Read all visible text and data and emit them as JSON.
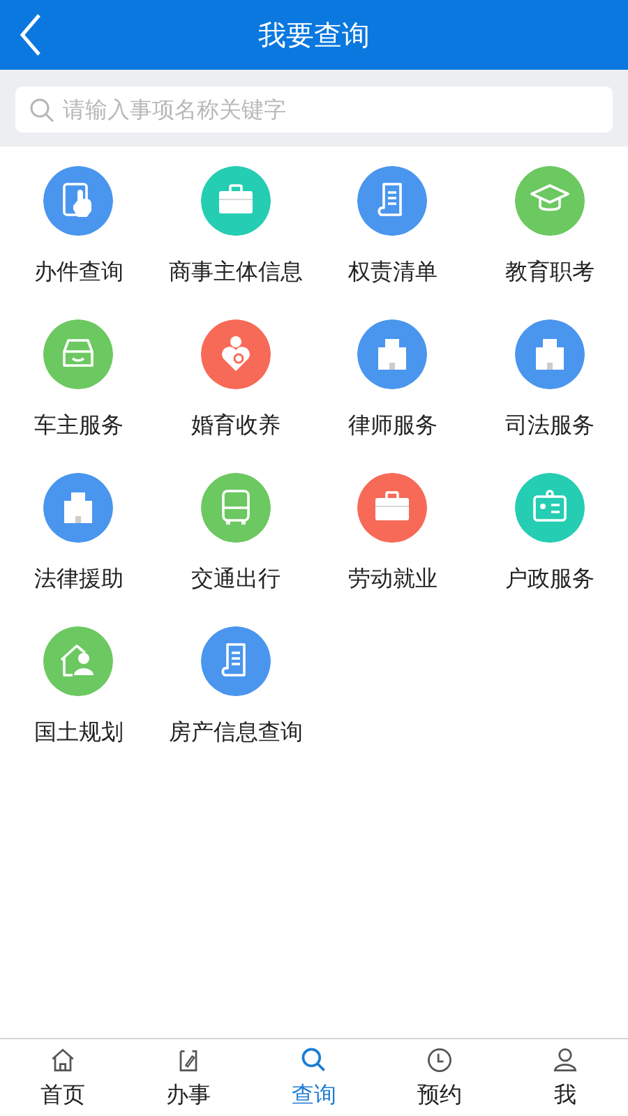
{
  "header": {
    "title": "我要查询"
  },
  "search": {
    "placeholder": "请输入事项名称关键字"
  },
  "services": [
    {
      "label": "办件查询",
      "kind": "document",
      "color": "#4a96ee"
    },
    {
      "label": "商事主体信息",
      "kind": "briefcase",
      "color": "#25cdb3"
    },
    {
      "label": "权责清单",
      "kind": "scroll",
      "color": "#4a96ee"
    },
    {
      "label": "教育职考",
      "kind": "cap",
      "color": "#6cc860"
    },
    {
      "label": "车主服务",
      "kind": "car",
      "color": "#6cc860"
    },
    {
      "label": "婚育收养",
      "kind": "family",
      "color": "#f76a58"
    },
    {
      "label": "律师服务",
      "kind": "building",
      "color": "#4a96ee"
    },
    {
      "label": "司法服务",
      "kind": "building",
      "color": "#4a96ee"
    },
    {
      "label": "法律援助",
      "kind": "building",
      "color": "#4a96ee"
    },
    {
      "label": "交通出行",
      "kind": "bus",
      "color": "#6cc860"
    },
    {
      "label": "劳动就业",
      "kind": "briefcase",
      "color": "#f76a58"
    },
    {
      "label": "户政服务",
      "kind": "idcard",
      "color": "#25cdb3"
    },
    {
      "label": "国土规划",
      "kind": "house",
      "color": "#6cc860"
    },
    {
      "label": "房产信息查询",
      "kind": "scroll",
      "color": "#4a96ee"
    }
  ],
  "tabs": [
    {
      "label": "首页",
      "kind": "home",
      "selected": false
    },
    {
      "label": "办事",
      "kind": "task",
      "selected": false
    },
    {
      "label": "查询",
      "kind": "search",
      "selected": true
    },
    {
      "label": "预约",
      "kind": "clock",
      "selected": false
    },
    {
      "label": "我",
      "kind": "person",
      "selected": false
    }
  ]
}
